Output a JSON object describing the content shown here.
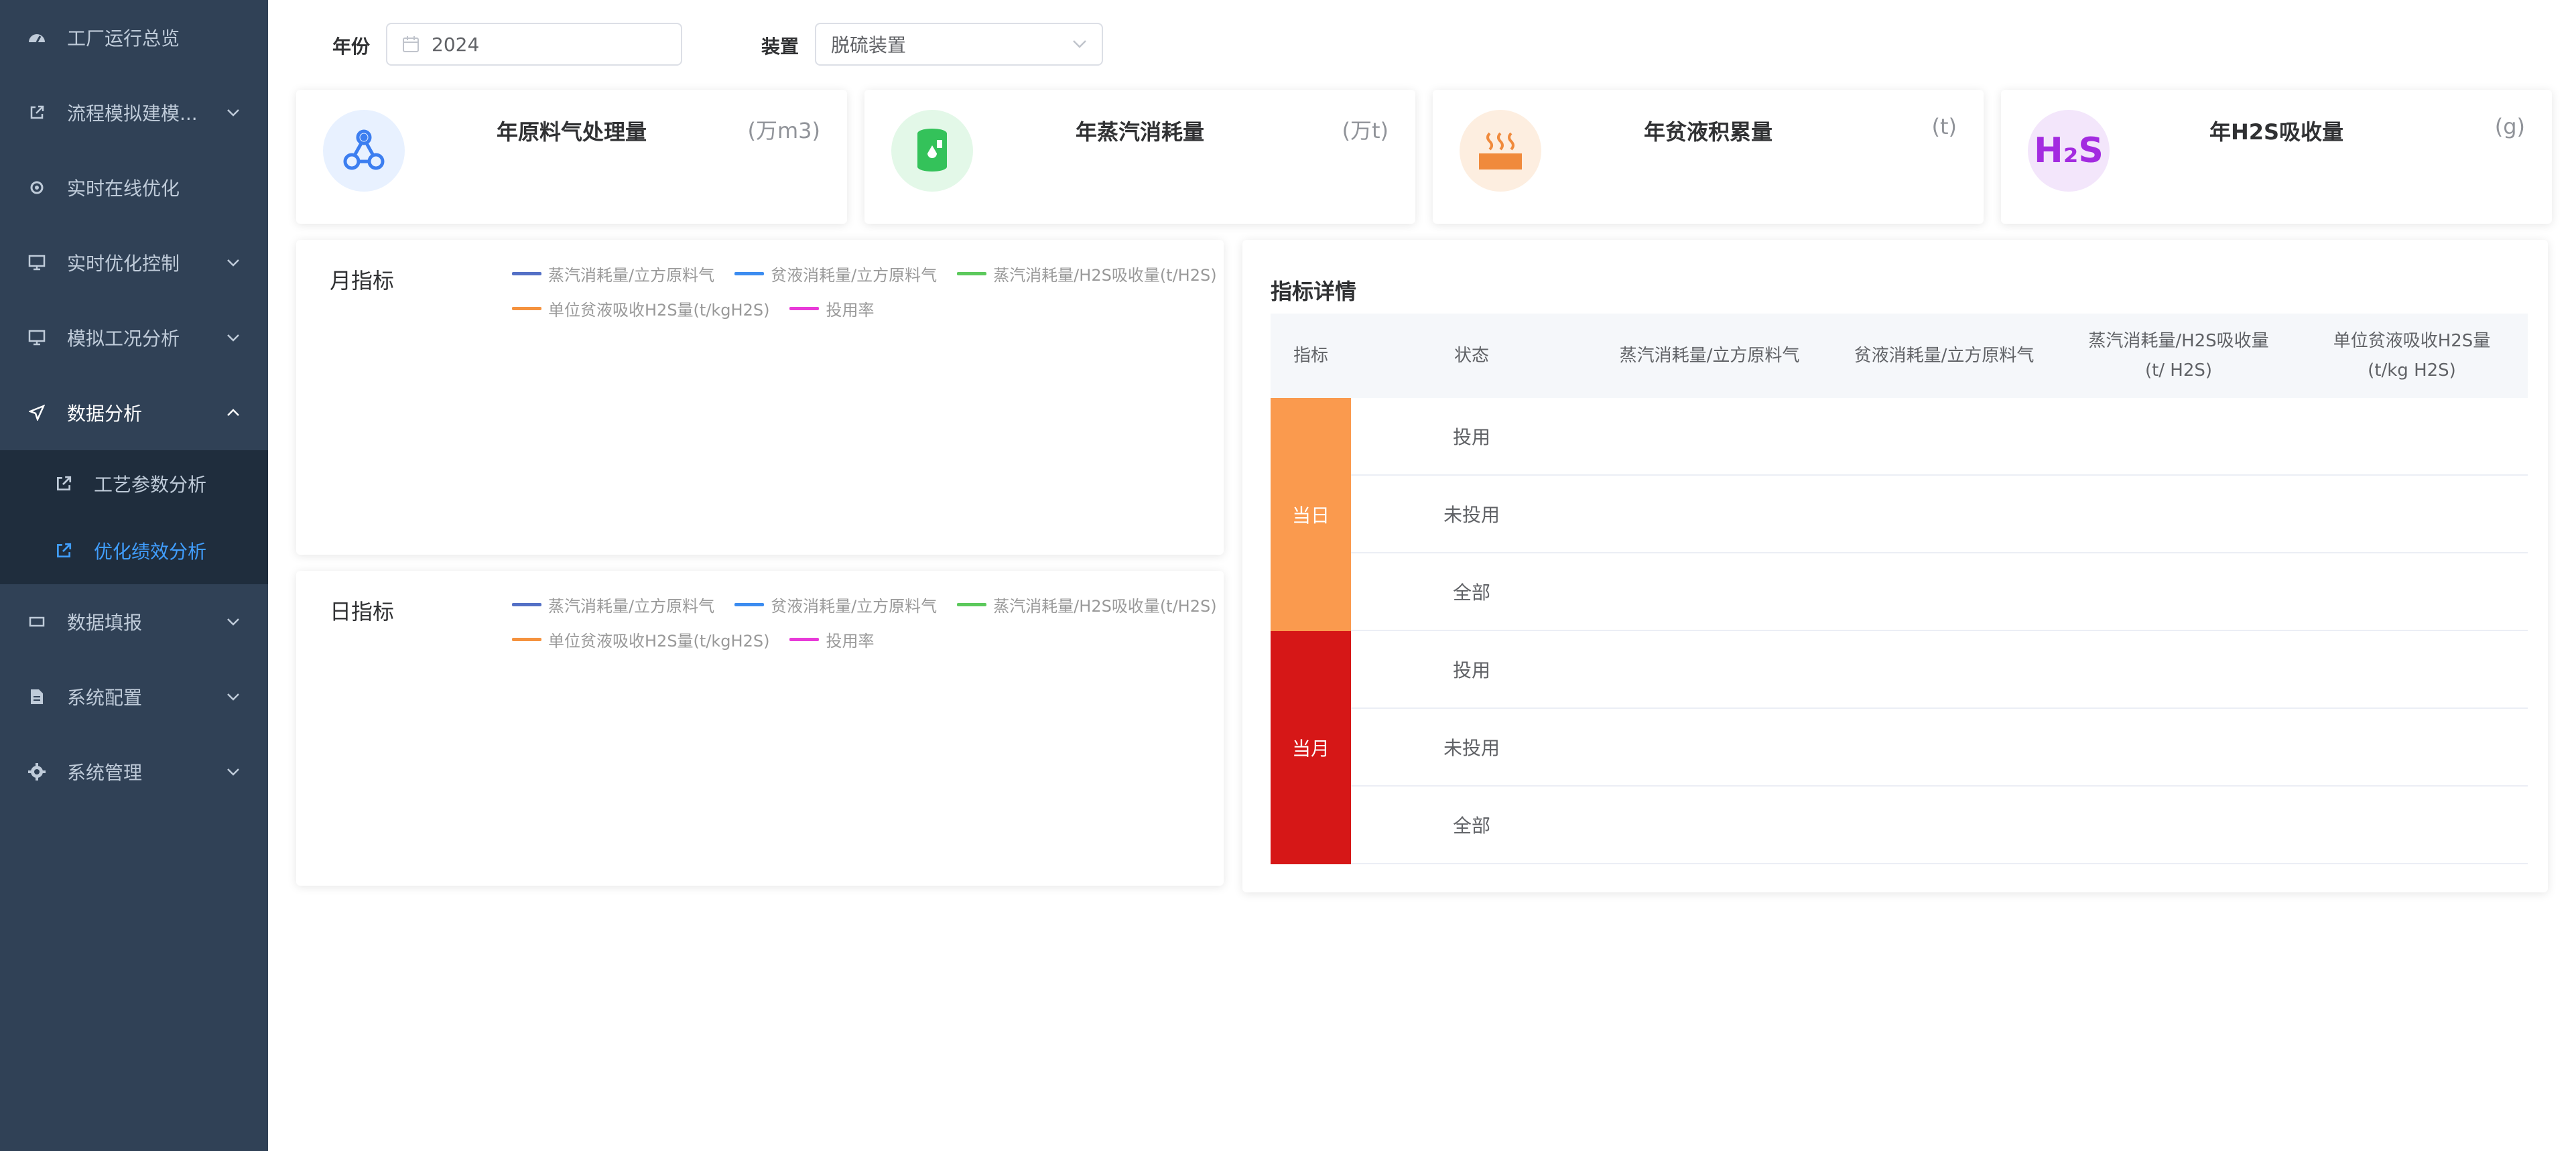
{
  "sidebar": {
    "items": [
      {
        "label": "工厂运行总览",
        "icon": "dashboard-icon",
        "has_children": false
      },
      {
        "label": "流程模拟建模...",
        "icon": "external-link-icon",
        "has_children": true
      },
      {
        "label": "实时在线优化",
        "icon": "settings-icon",
        "has_children": false
      },
      {
        "label": "实时优化控制",
        "icon": "monitor-icon",
        "has_children": true
      },
      {
        "label": "模拟工况分析",
        "icon": "monitor-icon",
        "has_children": true
      },
      {
        "label": "数据分析",
        "icon": "send-icon",
        "has_children": true,
        "expanded": true
      },
      {
        "label": "数据填报",
        "icon": "rectangle-icon",
        "has_children": true
      },
      {
        "label": "系统配置",
        "icon": "document-icon",
        "has_children": true
      },
      {
        "label": "系统管理",
        "icon": "gear-icon",
        "has_children": true
      }
    ],
    "sub_items": [
      {
        "label": "工艺参数分析",
        "icon": "external-link-icon",
        "active": false
      },
      {
        "label": "优化绩效分析",
        "icon": "external-link-icon",
        "active": true
      }
    ],
    "active_color": "#409eff",
    "bg_color": "#304156"
  },
  "filters": {
    "year_label": "年份",
    "year_value": "2024",
    "device_label": "装置",
    "device_value": "脱硫装置"
  },
  "cards": [
    {
      "title": "年原料气处理量",
      "unit": "(万m3)",
      "icon": "molecule-icon",
      "icon_bg": "#e8f1ff",
      "icon_color": "#3c7ef0"
    },
    {
      "title": "年蒸汽消耗量",
      "unit": "(万t)",
      "icon": "barrel-icon",
      "icon_bg": "#e3f8e8",
      "icon_color": "#34c25a"
    },
    {
      "title": "年贫液积累量",
      "unit": "(t)",
      "icon": "heat-icon",
      "icon_bg": "#fdeee0",
      "icon_color": "#f08a3c"
    },
    {
      "title": "年H2S吸收量",
      "unit": "(g)",
      "icon": "h2s-icon",
      "icon_text": "H₂S",
      "icon_bg": "#f3e6fb",
      "icon_color": "#a32be0"
    }
  ],
  "monthly": {
    "title": "月指标",
    "legend": [
      {
        "name": "蒸汽消耗量/立方原料气",
        "color": "#5470c6"
      },
      {
        "name": "贫液消耗量/立方原料气",
        "color": "#3c8cf0"
      },
      {
        "name": "蒸汽消耗量/H2S吸收量(t/H2S)",
        "color": "#5cc95c"
      },
      {
        "name": "单位贫液吸收H2S量(t/kgH2S)",
        "color": "#f5923e"
      },
      {
        "name": "投用率",
        "color": "#e83ad8"
      }
    ]
  },
  "daily": {
    "title": "日指标",
    "legend": [
      {
        "name": "蒸汽消耗量/立方原料气",
        "color": "#5470c6"
      },
      {
        "name": "贫液消耗量/立方原料气",
        "color": "#3c8cf0"
      },
      {
        "name": "蒸汽消耗量/H2S吸收量(t/H2S)",
        "color": "#5cc95c"
      },
      {
        "name": "单位贫液吸收H2S量(t/kgH2S)",
        "color": "#f5923e"
      },
      {
        "name": "投用率",
        "color": "#e83ad8"
      }
    ]
  },
  "detail": {
    "title": "指标详情",
    "headers": [
      "指标",
      "状态",
      "蒸汽消耗量/立方原料气",
      "贫液消耗量/立方原料气",
      "蒸汽消耗量/H2S吸收量(t/ H2S)",
      "单位贫液吸收H2S量(t/kg H2S)"
    ],
    "groups": [
      {
        "label": "当日",
        "color": "#fa9a4e",
        "rows": [
          "投用",
          "未投用",
          "全部"
        ]
      },
      {
        "label": "当月",
        "color": "#d61717",
        "rows": [
          "投用",
          "未投用",
          "全部"
        ]
      }
    ]
  }
}
